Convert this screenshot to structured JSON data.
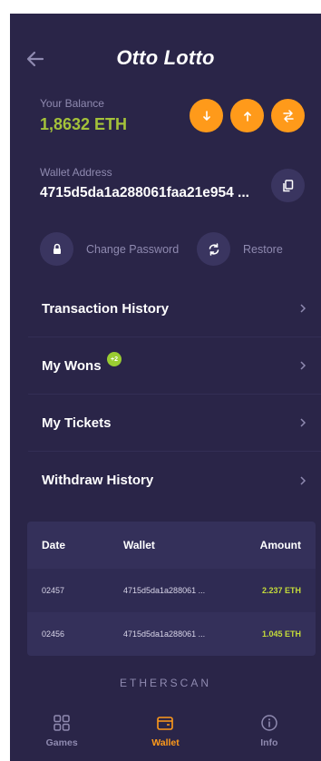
{
  "header": {
    "title": "Otto Lotto"
  },
  "balance": {
    "label": "Your Balance",
    "value": "1,8632 ETH"
  },
  "wallet": {
    "label": "Wallet Address",
    "value": "4715d5da1a288061faa21e954 ..."
  },
  "options": {
    "change_password": "Change Password",
    "restore": "Restore"
  },
  "menu": {
    "items": [
      {
        "label": "Transaction History"
      },
      {
        "label": "My Wons",
        "badge": "+2"
      },
      {
        "label": "My Tickets"
      },
      {
        "label": "Withdraw History"
      }
    ]
  },
  "table": {
    "headers": {
      "date": "Date",
      "wallet": "Wallet",
      "amount": "Amount"
    },
    "rows": [
      {
        "date": "02457",
        "wallet": "4715d5da1a288061 ...",
        "amount": "2.237 ETH"
      },
      {
        "date": "02456",
        "wallet": "4715d5da1a288061 ...",
        "amount": "1.045 ETH"
      }
    ]
  },
  "footer_link": "ETHERSCAN",
  "nav": {
    "games": "Games",
    "wallet": "Wallet",
    "info": "Info"
  },
  "colors": {
    "background": "#2a2548",
    "accent": "#ff9a1a",
    "balance": "#a4c23a",
    "amount": "#c5dc3a",
    "badge": "#9acd32"
  }
}
